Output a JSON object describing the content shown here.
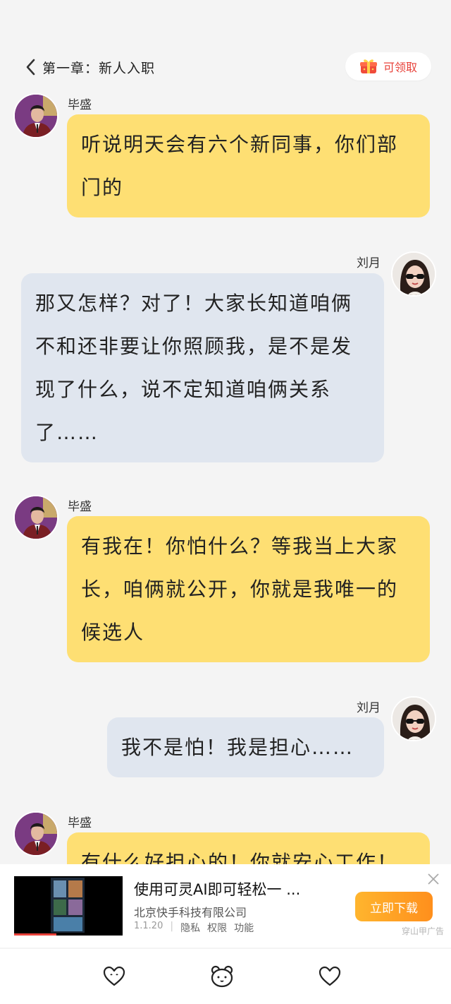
{
  "header": {
    "chapter_title": "第一章：新人入职",
    "claim_label": "可领取"
  },
  "messages": [
    {
      "speaker": "毕盛",
      "side": "left",
      "text": "听说明天会有六个新同事，你们部门的"
    },
    {
      "speaker": "刘月",
      "side": "right",
      "text": "那又怎样？对了！大家长知道咱俩不和还非要让你照顾我，是不是发现了什么，说不定知道咱俩关系了……"
    },
    {
      "speaker": "毕盛",
      "side": "left",
      "text": "有我在！你怕什么？等我当上大家长，咱俩就公开，你就是我唯一的候选人"
    },
    {
      "speaker": "刘月",
      "side": "right",
      "text": "我不是怕！我是担心……"
    },
    {
      "speaker": "毕盛",
      "side": "left",
      "text": "有什么好担心的！你就安心工作！"
    }
  ],
  "ad": {
    "title": "使用可灵AI即可轻松一 ...",
    "company": "北京快手科技有限公司",
    "version": "1.1.20",
    "privacy": "隐私",
    "permissions": "权限",
    "features": "功能",
    "download_label": "立即下载",
    "ad_label": "穿山甲广告"
  },
  "colors": {
    "left_bubble": "#fedf73",
    "right_bubble": "#e0e6ef",
    "accent": "#ff9a22"
  },
  "icons": [
    "back-icon",
    "gift-icon",
    "close-icon",
    "heart-outline-icon",
    "bear-face-icon"
  ]
}
